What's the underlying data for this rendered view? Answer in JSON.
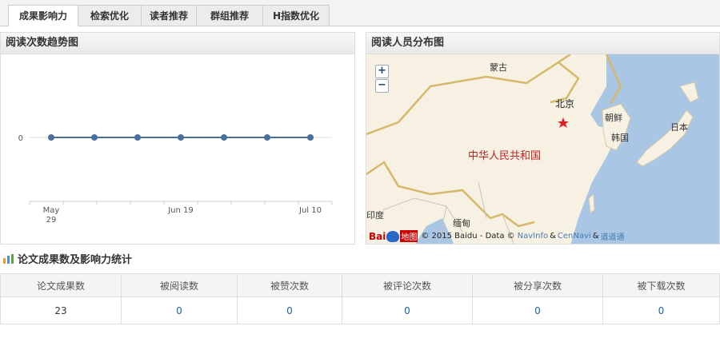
{
  "tabs": [
    {
      "label": "成果影响力",
      "active": true
    },
    {
      "label": "检索优化",
      "active": false
    },
    {
      "label": "读者推荐",
      "active": false
    },
    {
      "label": "群组推荐",
      "active": false
    },
    {
      "label": "H指数优化",
      "active": false
    }
  ],
  "trend_panel": {
    "title": "阅读次数趋势图"
  },
  "map_panel": {
    "title": "阅读人员分布图",
    "zoom_in": "+",
    "zoom_out": "−",
    "labels": {
      "mongolia": "蒙古",
      "beijing": "北京",
      "north_korea": "朝鲜",
      "south_korea": "韩国",
      "japan": "日本",
      "china": "中华人民共和国",
      "india": "印度",
      "myanmar": "缅甸"
    },
    "logo_left": "Bai",
    "logo_right": "地图",
    "copyright_prefix": "© 2015 Baidu - Data ©",
    "copyright_link1": "NavInfo",
    "copyright_amp": "&",
    "copyright_link2": "CenNavi",
    "copyright_amp2": "&",
    "copyright_link3": "道道通"
  },
  "chart_data": {
    "type": "line",
    "x": [
      "May 29",
      "Jun 5",
      "Jun 12",
      "Jun 19",
      "Jun 26",
      "Jul 3",
      "Jul 10"
    ],
    "x_tick_labels": [
      "May 29",
      "Jun 19",
      "Jul 10"
    ],
    "series": [
      {
        "values": [
          0,
          0,
          0,
          0,
          0,
          0,
          0
        ],
        "color": "#4a6f9b"
      }
    ],
    "y_tick_labels": [
      "0"
    ],
    "grid": true
  },
  "stats": {
    "title": "论文成果数及影响力统计",
    "headers": [
      "论文成果数",
      "被阅读数",
      "被赞次数",
      "被评论次数",
      "被分享次数",
      "被下载次数"
    ],
    "values": [
      "23",
      "0",
      "0",
      "0",
      "0",
      "0"
    ]
  }
}
